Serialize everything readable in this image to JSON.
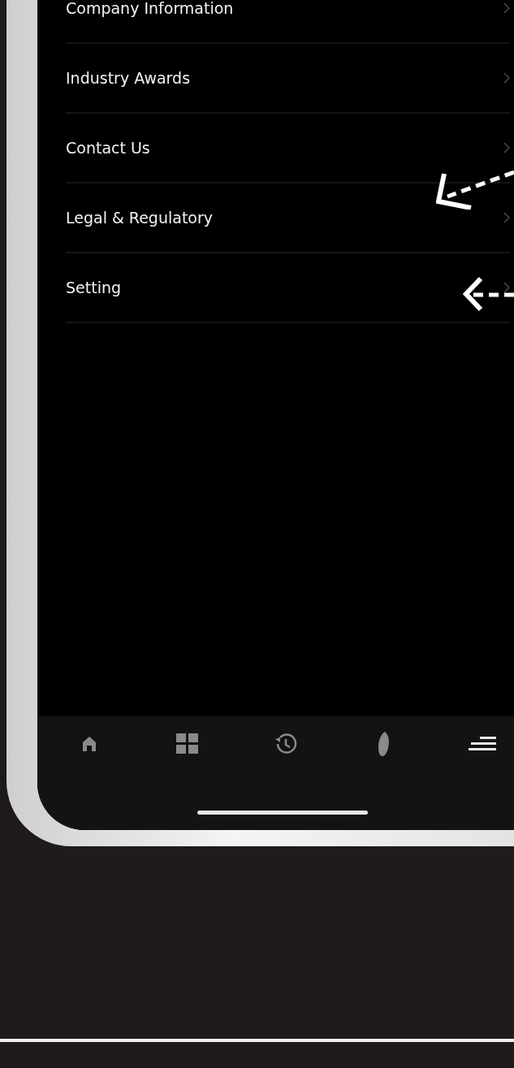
{
  "menu_items": [
    {
      "label": "Company Information"
    },
    {
      "label": "Industry Awards"
    },
    {
      "label": "Contact Us"
    },
    {
      "label": "Legal & Regulatory"
    },
    {
      "label": "Setting"
    }
  ],
  "tab_bar": [
    {
      "kind": "home",
      "selected": false
    },
    {
      "kind": "grid",
      "selected": false
    },
    {
      "kind": "history",
      "selected": false
    },
    {
      "kind": "leaf",
      "selected": false
    },
    {
      "kind": "menu",
      "selected": true
    }
  ]
}
